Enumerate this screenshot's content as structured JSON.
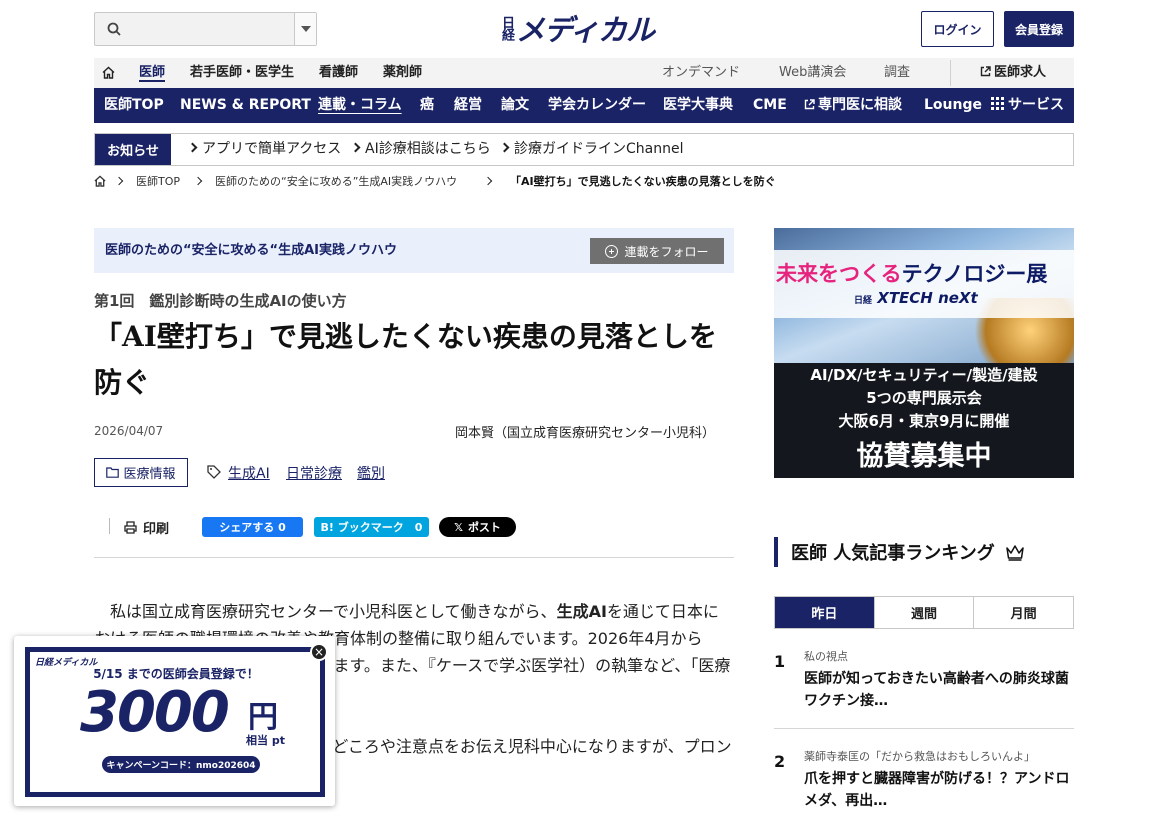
{
  "header": {
    "logo_small": "日経",
    "logo_big": "メディカル",
    "login": "ログイン",
    "register": "会員登録"
  },
  "nav_primary": {
    "home_icon": "home-icon",
    "items": [
      "医師",
      "若手医師・医学生",
      "看護師",
      "薬剤師"
    ],
    "sub_items": [
      "オンデマンド",
      "Web講演会",
      "調査"
    ],
    "recruit": "医師求人"
  },
  "nav_secondary": {
    "items": [
      "医師TOP",
      "NEWS & REPORT",
      "連載・コラム",
      "癌",
      "経営",
      "論文",
      "学会カレンダー",
      "医学大事典",
      "CME",
      "専門医に相談",
      "Lounge",
      "サービス"
    ]
  },
  "notice": {
    "label": "お知らせ",
    "links": [
      "アプリで簡単アクセス",
      "AI診療相談はこちら",
      "診療ガイドラインChannel"
    ]
  },
  "breadcrumb": [
    "医師TOP",
    "医師のための“安全に攻める”生成AI実践ノウハウ",
    "「AI壁打ち」で見逃したくない疾患の見落としを防ぐ"
  ],
  "article": {
    "series_title": "医師のための“安全に攻める“生成AI実践ノウハウ",
    "follow_label": "連載をフォロー",
    "subhead": "第1回　鑑別診断時の生成AIの使い方",
    "headline": "「AI壁打ち」で見逃したくない疾患の見落としを防ぐ",
    "date": "2026/04/07",
    "author": "岡本賢（国立成育医療研究センター小児科）",
    "category": "医療情報",
    "keywords": [
      "生成AI",
      "日常診療",
      "鑑別"
    ],
    "print_label": "印刷",
    "share_facebook": "シェアする 0",
    "share_hatena": "B! ブックマーク　0",
    "share_x": "ポスト",
    "body_p1_a": "私は国立成育医療研究センターで小児科医として働きながら、",
    "body_p1_bold": "生成AI",
    "body_p1_b": "を通じて日本における医師の職場環境の改善や教育体制の整備に取り組んでいます。2026年4月からは、母でも臨床業務に従事しています。また、『ケースで学ぶ医学社）の執筆など、「医療×AI」をテーマにした情報発",
    "body_p2": "使えるプロンプトと、その使いどころや注意点をお伝え児科中心になりますが、プロンプトの考え方自体はどの"
  },
  "ad": {
    "line1_pink": "未来をつくる",
    "line1_navy": "テクノロジー展",
    "brand_small": "日経",
    "brand": "XTECH neXt",
    "line2": "AI/DX/セキュリティー/製造/建設",
    "line3": "5つの専門展示会",
    "line4": "大阪6月・東京9月に開催",
    "line5": "協賛募集中"
  },
  "ranking": {
    "title": "医師 人気記事ランキング",
    "tabs": [
      "昨日",
      "週間",
      "月間"
    ],
    "items": [
      {
        "rank": "1",
        "category": "私の視点",
        "title": "医師が知っておきたい高齢者への肺炎球菌ワクチン接…"
      },
      {
        "rank": "2",
        "category": "薬師寺泰匡の「だから救急はおもしろいんよ」",
        "title": "爪を押すと臓器障害が防げる！？アンドロメダ、再出…"
      }
    ]
  },
  "popup": {
    "logo": "日経メディカル",
    "line1": "5/15 までの医師会員登録で！",
    "amount": "3000",
    "yen": "円",
    "pt": "相当 pt",
    "code": "キャンペーンコード：nmo202604",
    "close": "×"
  }
}
